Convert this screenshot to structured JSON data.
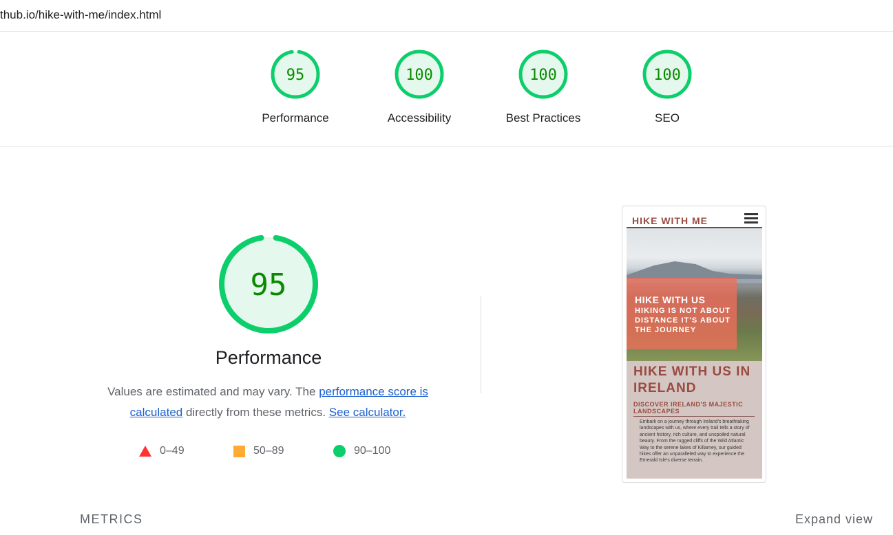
{
  "url": "thub.io/hike-with-me/index.html",
  "scores": [
    {
      "label": "Performance",
      "value": "95",
      "fraction": 0.95
    },
    {
      "label": "Accessibility",
      "value": "100",
      "fraction": 1.0
    },
    {
      "label": "Best Practices",
      "value": "100",
      "fraction": 1.0
    },
    {
      "label": "SEO",
      "value": "100",
      "fraction": 1.0
    }
  ],
  "performance": {
    "score": "95",
    "fraction": 0.95,
    "title": "Performance",
    "desc_part1": "Values are estimated and may vary. The ",
    "link1": "performance score is calculated",
    "desc_part2": " directly from these metrics. ",
    "link2": "See calculator."
  },
  "legend": [
    {
      "shape": "triangle",
      "label": "0–49",
      "color": "#ff3333"
    },
    {
      "shape": "square",
      "label": "50–89",
      "color": "#ffaa33"
    },
    {
      "shape": "circle",
      "label": "90–100",
      "color": "#0cce6b"
    }
  ],
  "colors": {
    "pass": "#0cce6b",
    "pass_text": "#0a8a00",
    "pass_bg": "#e5f8ee",
    "link": "#1a5fd1"
  },
  "screenshot": {
    "brand": "HIKE WITH ME",
    "hero_heading": "HIKE WITH US",
    "hero_tagline": "HIKING IS NOT ABOUT DISTANCE IT'S ABOUT THE JOURNEY",
    "heading": "HIKE WITH US IN IRELAND",
    "subheading": "DISCOVER IRELAND'S MAJESTIC LANDSCAPES",
    "paragraph": "Embark on a journey through Ireland's breathtaking landscapes with us, where every trail tells a story of ancient history, rich culture, and unspoiled natural beauty. From the rugged cliffs of the Wild Atlantic Way to the serene lakes of Killarney, our guided hikes offer an unparalleled way to experience the Emerald Isle's diverse terrain."
  },
  "footer": {
    "metrics": "METRICS",
    "expand": "Expand view"
  }
}
